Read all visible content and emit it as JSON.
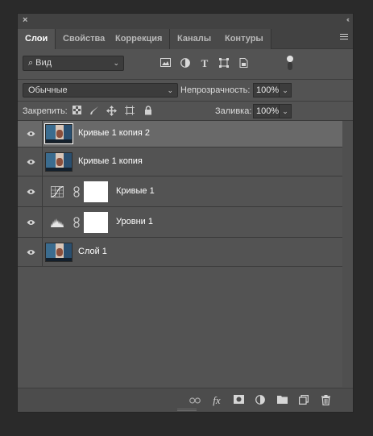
{
  "window": {
    "close_glyph": "×",
    "collapse_glyph": "‹‹"
  },
  "tabs": [
    {
      "label": "Слои",
      "active": true
    },
    {
      "label": "Свойства",
      "active": false
    },
    {
      "label": "Коррекция",
      "active": false
    },
    {
      "label": "Каналы",
      "active": false
    },
    {
      "label": "Контуры",
      "active": false
    }
  ],
  "filter": {
    "kind_label": "Вид",
    "icons": [
      "image-filter-icon",
      "adjustment-filter-icon",
      "type-filter-icon",
      "shape-filter-icon",
      "smart-object-filter-icon"
    ],
    "toggle_icon": "filter-toggle-icon"
  },
  "blend": {
    "mode": "Обычные",
    "opacity_label": "Непрозрачность:",
    "opacity_value": "100%",
    "lock_label": "Закрепить:",
    "fill_label": "Заливка:",
    "fill_value": "100%"
  },
  "layers": [
    {
      "name": "Кривые 1 копия 2",
      "type": "pixel",
      "visible": true,
      "selected": true
    },
    {
      "name": "Кривые 1 копия",
      "type": "pixel",
      "visible": true,
      "selected": false
    },
    {
      "name": "Кривые 1",
      "type": "curves-adjustment",
      "visible": true,
      "selected": false
    },
    {
      "name": "Уровни 1",
      "type": "levels-adjustment",
      "visible": true,
      "selected": false
    },
    {
      "name": "Слой 1",
      "type": "pixel",
      "visible": true,
      "selected": false
    }
  ],
  "bottom_icons": [
    "link-layers-icon",
    "fx-icon",
    "add-mask-icon",
    "new-adjustment-icon",
    "new-group-icon",
    "new-layer-icon",
    "delete-layer-icon"
  ],
  "bottom_fx_label": "fx",
  "colors": {
    "panel": "#535353",
    "selected_row": "#696969",
    "tab_bar": "#424242",
    "text": "#dcdcdc"
  }
}
